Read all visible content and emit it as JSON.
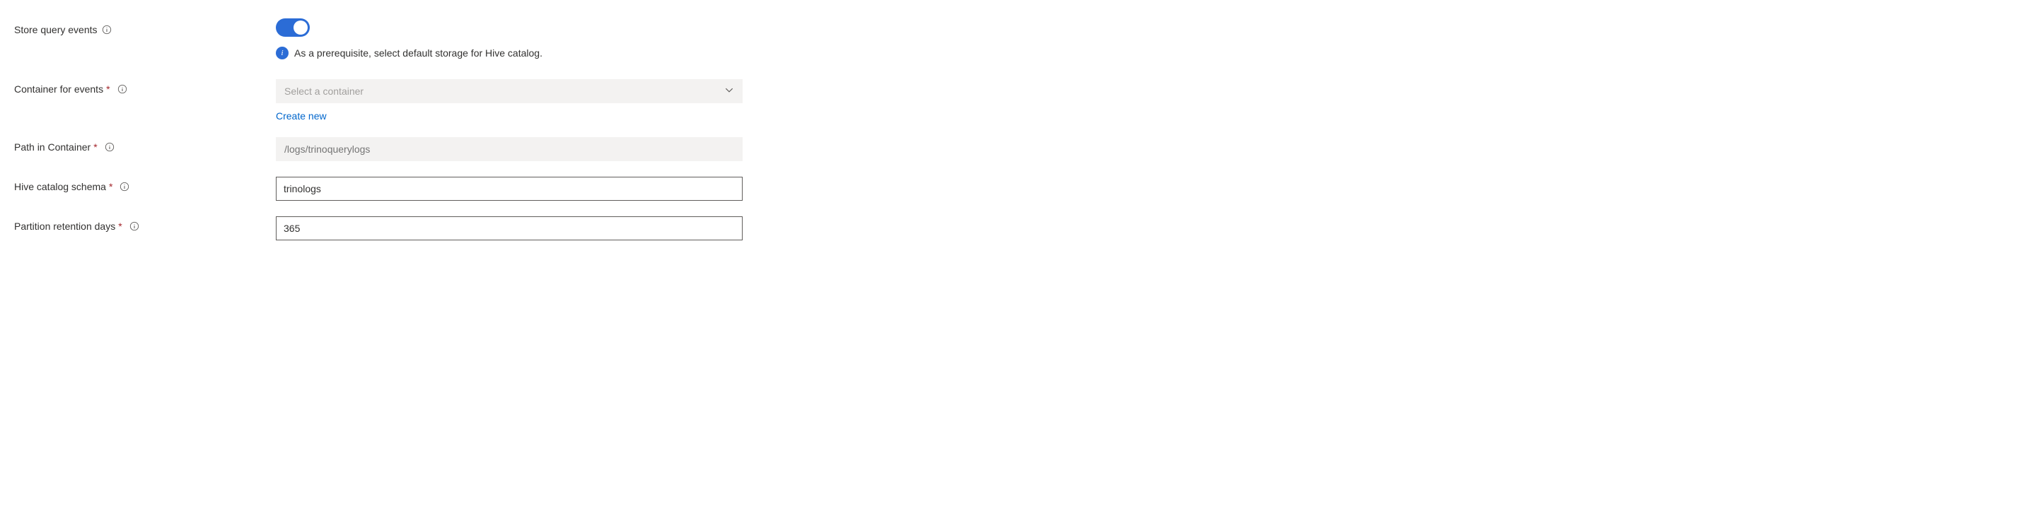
{
  "fields": {
    "storeQueryEvents": {
      "label": "Store query events",
      "toggle_on": true,
      "info_text": "As a prerequisite, select default storage for Hive catalog."
    },
    "containerForEvents": {
      "label": "Container for events",
      "placeholder": "Select a container",
      "create_new_label": "Create new"
    },
    "pathInContainer": {
      "label": "Path in Container",
      "placeholder": "/logs/trinoquerylogs",
      "value": ""
    },
    "hiveCatalogSchema": {
      "label": "Hive catalog schema",
      "value": "trinologs"
    },
    "partitionRetentionDays": {
      "label": "Partition retention days",
      "value": "365"
    }
  }
}
